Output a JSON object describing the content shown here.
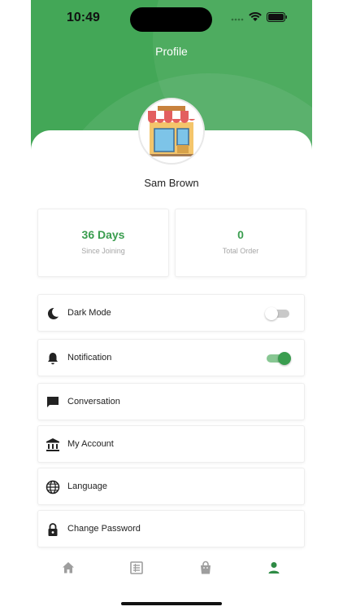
{
  "status_bar": {
    "time": "10:49"
  },
  "header": {
    "title": "Profile"
  },
  "profile": {
    "name": "Sam Brown",
    "avatar": "store-icon"
  },
  "stats": [
    {
      "value": "36 Days",
      "label": "Since Joining"
    },
    {
      "value": "0",
      "label": "Total Order"
    }
  ],
  "menu": [
    {
      "label": "Dark Mode",
      "icon": "moon-icon",
      "toggle": false
    },
    {
      "label": "Notification",
      "icon": "bell-icon",
      "toggle": true
    },
    {
      "label": "Conversation",
      "icon": "chat-icon"
    },
    {
      "label": "My Account",
      "icon": "bank-icon"
    },
    {
      "label": "Language",
      "icon": "globe-icon"
    },
    {
      "label": "Change Password",
      "icon": "lock-icon"
    }
  ],
  "bottom_nav": [
    {
      "icon": "home-icon",
      "active": false
    },
    {
      "icon": "orders-icon",
      "active": false
    },
    {
      "icon": "bag-icon",
      "active": false
    },
    {
      "icon": "person-icon",
      "active": true
    }
  ],
  "colors": {
    "primary": "#43a757",
    "accent": "#3a9d4f",
    "inactive_icon": "#9e9e9e"
  }
}
